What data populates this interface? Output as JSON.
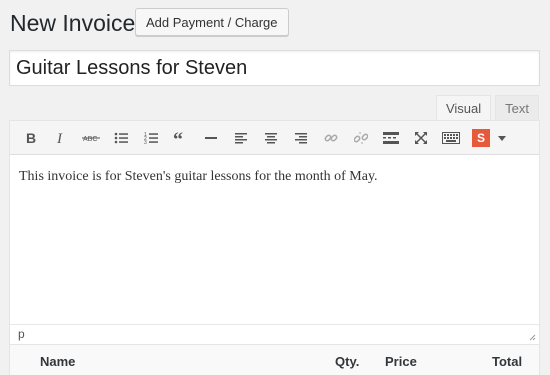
{
  "header": {
    "title": "New Invoice",
    "add_button": "Add Payment / Charge"
  },
  "invoice": {
    "title_value": "Guitar Lessons for Steven"
  },
  "editor": {
    "tabs": [
      {
        "label": "Visual",
        "active": true
      },
      {
        "label": "Text",
        "active": false
      }
    ],
    "toolbar": [
      {
        "icon": "bold-icon"
      },
      {
        "icon": "italic-icon"
      },
      {
        "icon": "strikethrough-icon"
      },
      {
        "icon": "bullet-list-icon"
      },
      {
        "icon": "numbered-list-icon"
      },
      {
        "icon": "blockquote-icon"
      },
      {
        "icon": "horizontal-rule-icon"
      },
      {
        "icon": "align-left-icon"
      },
      {
        "icon": "align-center-icon"
      },
      {
        "icon": "align-right-icon"
      },
      {
        "icon": "link-icon"
      },
      {
        "icon": "unlink-icon"
      },
      {
        "icon": "read-more-icon"
      },
      {
        "icon": "fullscreen-icon"
      },
      {
        "icon": "kitchen-sink-icon"
      },
      {
        "icon": "s-plugin-icon",
        "label": "S",
        "color": "#e65a3b"
      },
      {
        "icon": "dropdown-arrow-icon"
      }
    ],
    "content": "This invoice is for Steven's guitar lessons for the month of May.",
    "path": "p"
  },
  "table": {
    "columns": [
      "Name",
      "Qty.",
      "Price",
      "Total"
    ]
  }
}
